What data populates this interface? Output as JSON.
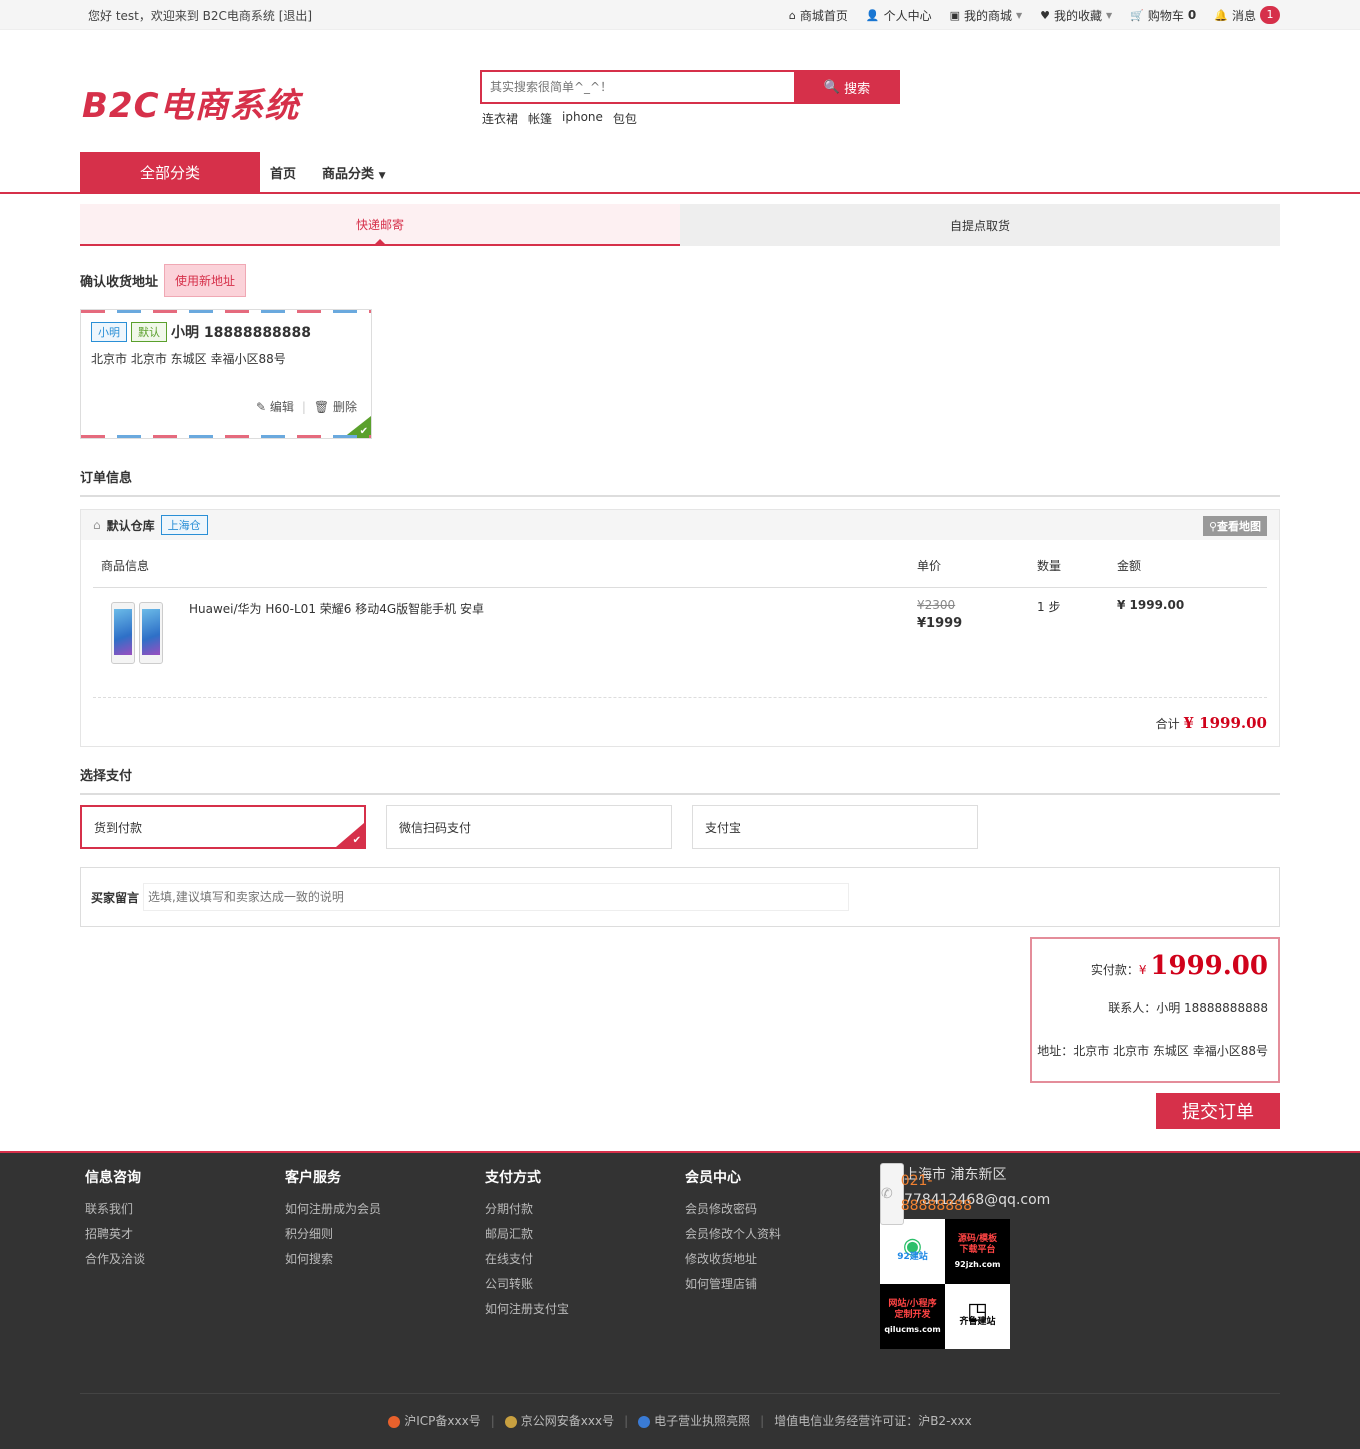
{
  "topbar": {
    "greeting": "您好 test，欢迎来到 B2C电商系统 [退出]",
    "nav": {
      "home": "商城首页",
      "user_center": "个人中心",
      "my_mall": "我的商城",
      "favorites": "我的收藏",
      "cart": "购物车",
      "cart_count": "0",
      "messages": "消息",
      "message_count": "1"
    }
  },
  "header": {
    "logo": "B2C电商系统",
    "search": {
      "placeholder": "其实搜索很简单^_^！",
      "button": "搜索"
    },
    "hot_words": [
      "连衣裙",
      "帐篷",
      "iphone",
      "包包"
    ]
  },
  "nav": {
    "all_categories": "全部分类",
    "links": [
      "首页",
      "商品分类"
    ]
  },
  "delivery_tabs": [
    "快递邮寄",
    "自提点取货"
  ],
  "address": {
    "section_title": "确认收货地址",
    "new_address": "使用新地址",
    "card": {
      "tag_name": "小明",
      "tag_default": "默认",
      "name_phone": "小明 18888888888",
      "address": "北京市 北京市 东城区 幸福小区88号",
      "edit": "编辑",
      "delete": "删除"
    }
  },
  "order": {
    "section_title": "订单信息",
    "warehouse": "默认仓库",
    "warehouse_tag": "上海仓",
    "map_button": "查看地图",
    "columns": [
      "商品信息",
      "单价",
      "数量",
      "金额"
    ],
    "items": [
      {
        "name": "Huawei/华为 H60-L01 荣耀6 移动4G版智能手机 安卓",
        "old_price": "¥2300",
        "price": "¥1999",
        "qty": "1 步",
        "amount": "¥ 1999.00"
      }
    ],
    "subtotal_label": "合计",
    "subtotal_value": "¥ 1999.00"
  },
  "payment": {
    "section_title": "选择支付",
    "options": [
      "货到付款",
      "微信扫码支付",
      "支付宝"
    ],
    "selected": 0
  },
  "message": {
    "label": "买家留言",
    "placeholder": "选填,建议填写和卖家达成一致的说明"
  },
  "summary": {
    "pay_label": "实付款：",
    "currency": "¥",
    "pay_value": "1999.00",
    "contact": "联系人：小明 18888888888",
    "address": "地址：北京市 北京市 东城区 幸福小区88号",
    "submit": "提交订单"
  },
  "footer": {
    "columns": [
      {
        "title": "信息咨询",
        "links": [
          "联系我们",
          "招聘英才",
          "合作及洽谈"
        ]
      },
      {
        "title": "客户服务",
        "links": [
          "如何注册成为会员",
          "积分细则",
          "如何搜索"
        ]
      },
      {
        "title": "支付方式",
        "links": [
          "分期付款",
          "邮局汇款",
          "在线支付",
          "公司转账",
          "如何注册支付宝"
        ]
      },
      {
        "title": "会员中心",
        "links": [
          "会员修改密码",
          "会员修改个人资料",
          "修改收货地址",
          "如何管理店铺"
        ]
      }
    ],
    "contact": {
      "phone": "021-88888888",
      "address": "上海市 浦东新区",
      "email": "778412468@qq.com"
    },
    "ads": {
      "a1": "92建站",
      "a2_line1": "源码/模板",
      "a2_line2": "下载平台",
      "a2_site": "92jzh.com",
      "a3_line1": "网站/小程序",
      "a3_line2": "定制开发",
      "a3_site": "qilucms.com",
      "a4": "齐鲁建站"
    },
    "bottom_links": [
      "沪ICP备xxx号",
      "京公网安备xxx号",
      "电子营业执照亮照",
      "增值电信业务经营许可证：沪B2-xxx"
    ]
  }
}
